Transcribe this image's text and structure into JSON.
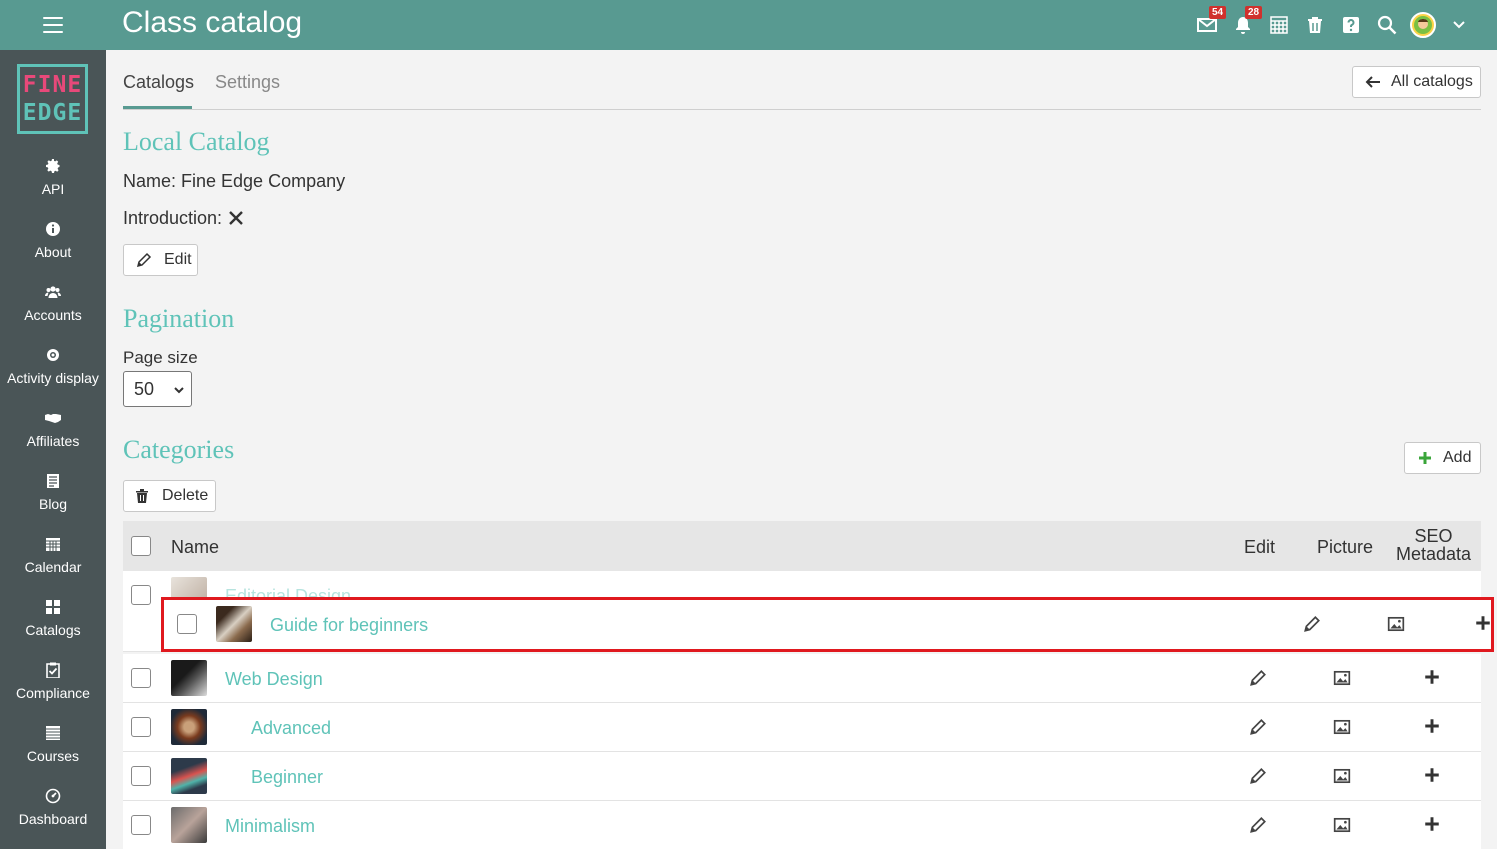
{
  "header": {
    "title": "Class catalog",
    "messages_badge": "54",
    "notifications_badge": "28"
  },
  "sidebar": {
    "logo_line1": "FINE",
    "logo_line2": "EDGE",
    "items": [
      {
        "label": "API",
        "icon": "gear-icon"
      },
      {
        "label": "About",
        "icon": "info-icon"
      },
      {
        "label": "Accounts",
        "icon": "users-icon"
      },
      {
        "label": "Activity display",
        "icon": "dot-circle-icon"
      },
      {
        "label": "Affiliates",
        "icon": "handshake-icon"
      },
      {
        "label": "Blog",
        "icon": "blog-icon"
      },
      {
        "label": "Calendar",
        "icon": "calendar-icon"
      },
      {
        "label": "Catalogs",
        "icon": "grid-icon"
      },
      {
        "label": "Compliance",
        "icon": "clipboard-check-icon"
      },
      {
        "label": "Courses",
        "icon": "courses-icon"
      },
      {
        "label": "Dashboard",
        "icon": "dashboard-icon"
      }
    ]
  },
  "tabs": {
    "catalogs": "Catalogs",
    "settings": "Settings"
  },
  "all_catalogs_button": "All catalogs",
  "local_catalog": {
    "title": "Local Catalog",
    "name_line": "Name: Fine Edge Company",
    "intro_label": "Introduction:",
    "edit_button": "Edit"
  },
  "pagination": {
    "title": "Pagination",
    "page_size_label": "Page size",
    "page_size_value": "50"
  },
  "categories": {
    "title": "Categories",
    "add_button": "Add",
    "delete_button": "Delete",
    "columns": {
      "name": "Name",
      "edit": "Edit",
      "picture": "Picture",
      "seo_line1": "SEO",
      "seo_line2": "Metadata"
    },
    "rows": [
      {
        "name": "Editorial Design",
        "indent": false
      },
      {
        "name": "Web Design",
        "indent": false
      },
      {
        "name": "Advanced",
        "indent": true
      },
      {
        "name": "Beginner",
        "indent": true
      },
      {
        "name": "Minimalism",
        "indent": false
      }
    ],
    "dragged_row": {
      "name": "Guide for beginners"
    }
  },
  "colors": {
    "topbar": "#589a91",
    "sidebar": "#4a5557",
    "accent": "#5fc3b8",
    "highlight": "#e0191f"
  }
}
